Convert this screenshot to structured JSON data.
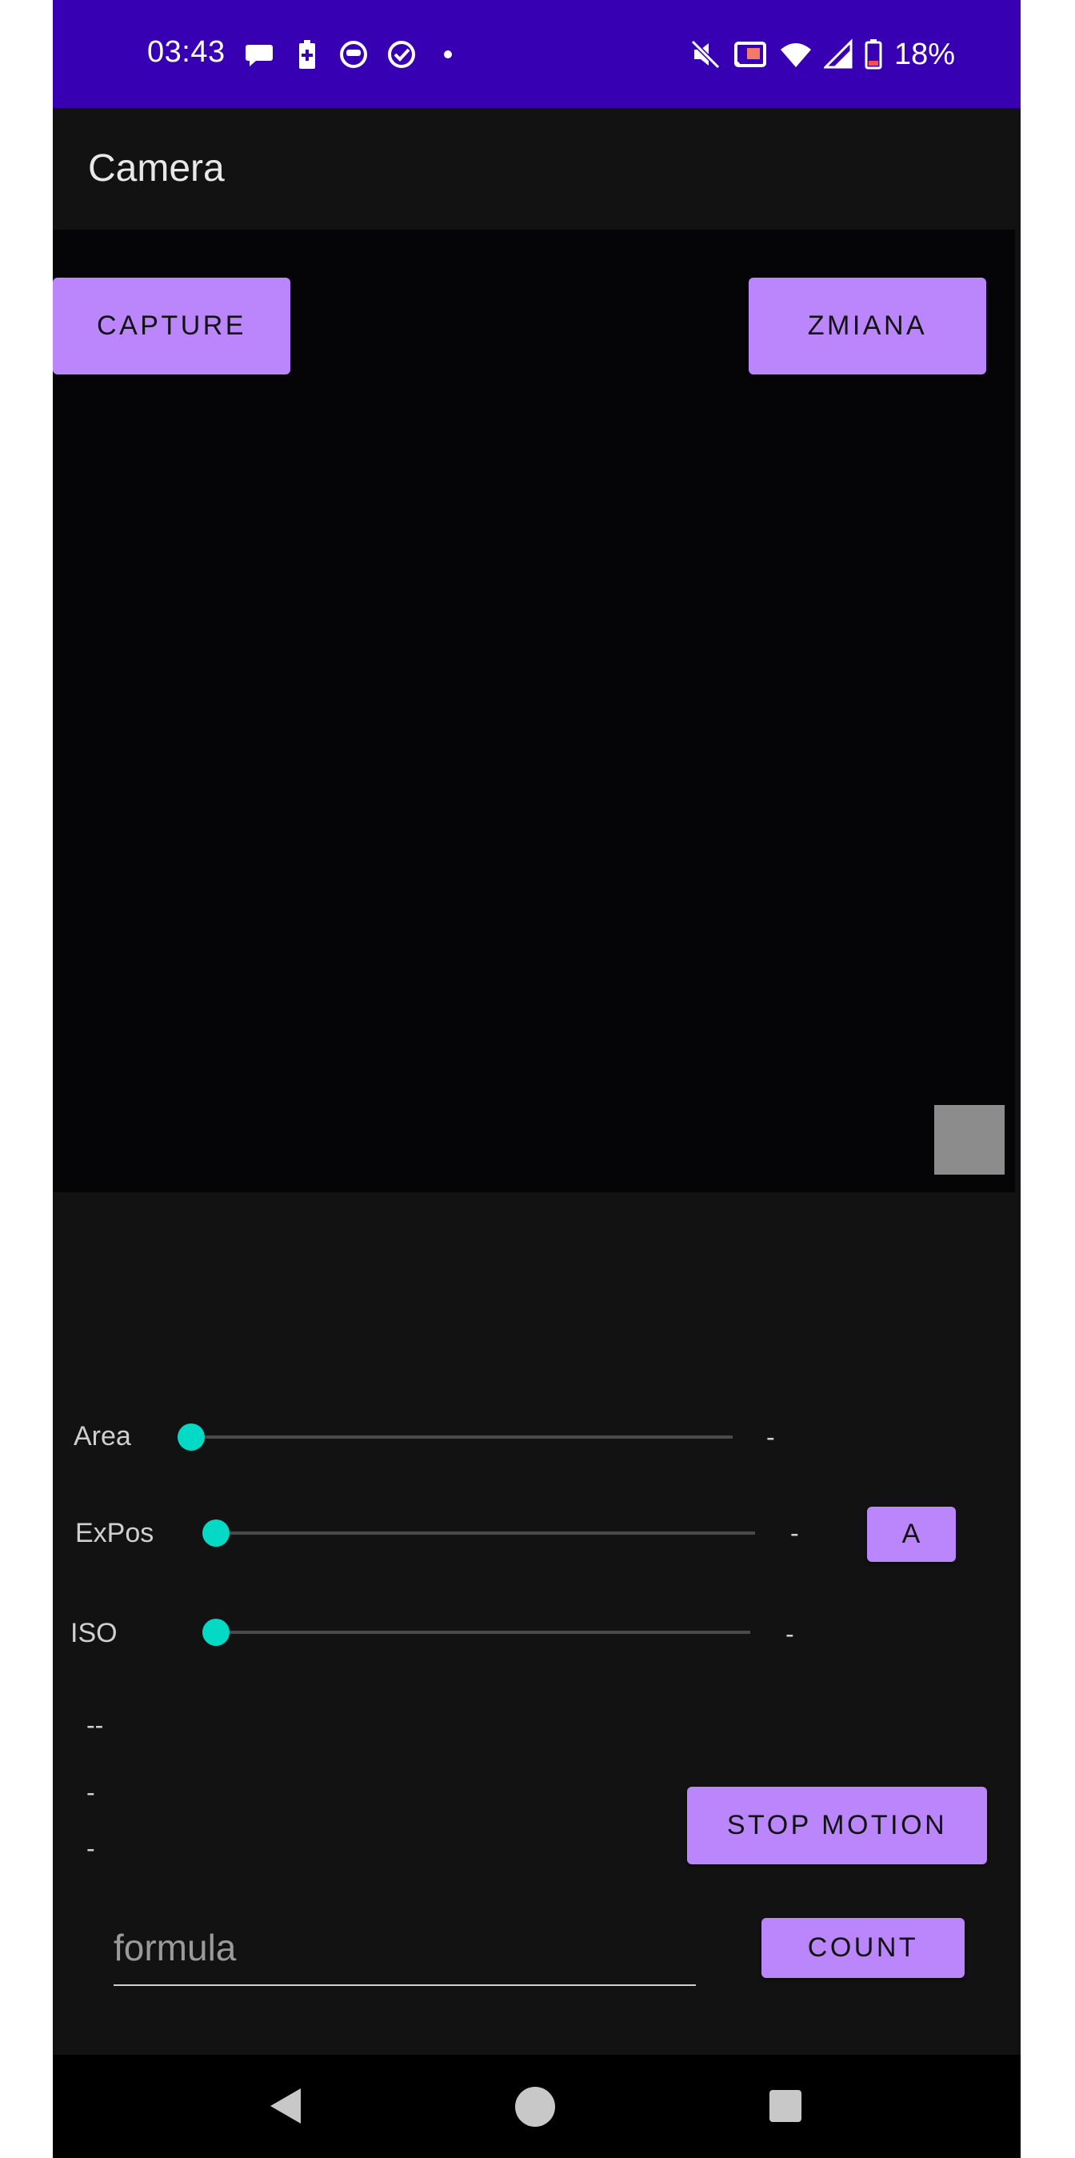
{
  "status_bar": {
    "time": "03:43",
    "battery_text": "18%",
    "left_icons": [
      "chat-bubble-icon",
      "battery-saver-icon",
      "app-icon",
      "check-circle-icon",
      "dot-icon"
    ],
    "right_icons": [
      "muted-icon",
      "cast-icon",
      "wifi-icon",
      "signal-icon",
      "battery-icon"
    ],
    "color": "#3700b3"
  },
  "app_bar": {
    "title": "Camera"
  },
  "preview": {
    "capture_label": "CAPTURE",
    "switch_label": "ZMIANA"
  },
  "controls": {
    "area": {
      "label": "Area",
      "value": "-",
      "level": 0
    },
    "expos": {
      "label": "ExPos",
      "value": "-",
      "level": 0,
      "auto_label": "A"
    },
    "iso": {
      "label": "ISO",
      "value": "-",
      "level": 0
    },
    "info_line_1": "--",
    "info_line_2": "-",
    "info_line_3": "-",
    "stop_motion_label": "STOP MOTION",
    "formula_placeholder": "formula",
    "count_label": "COUNT"
  },
  "colors": {
    "accent": "#bb86fc",
    "slider": "#03dac5",
    "background": "#121212"
  }
}
